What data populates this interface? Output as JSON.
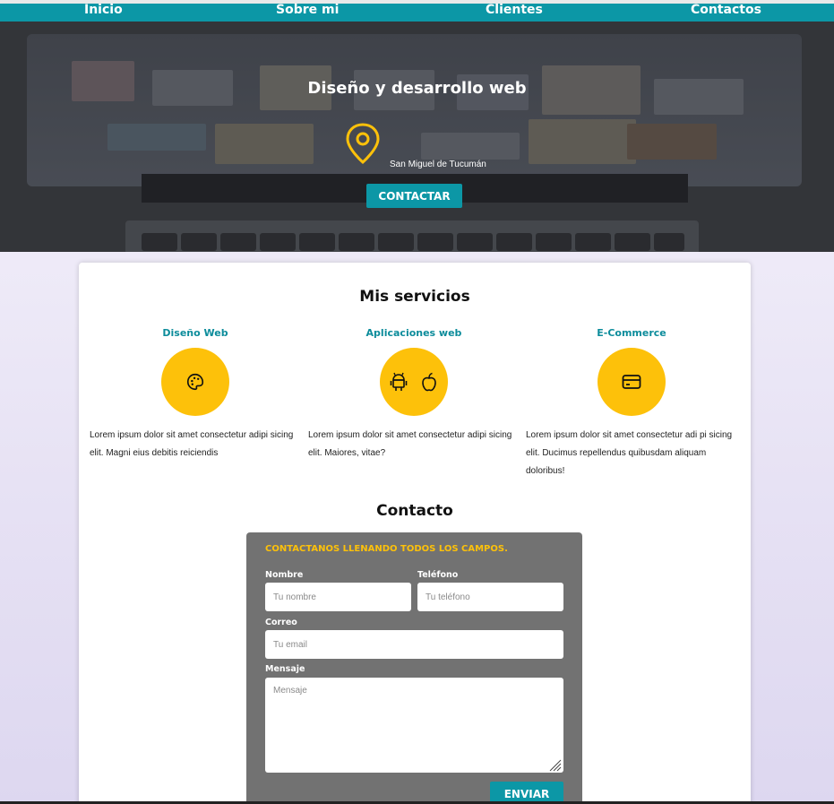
{
  "nav": {
    "items": [
      {
        "label": "Inicio"
      },
      {
        "label": "Sobre mi"
      },
      {
        "label": "Clientes"
      },
      {
        "label": "Contactos"
      }
    ]
  },
  "hero": {
    "title": "Diseño y desarrollo web",
    "location": "San Miguel de Tucumán",
    "button": "CONTACTAR",
    "icon": "location-pin-icon"
  },
  "services": {
    "title": "Mis servicios",
    "items": [
      {
        "name": "Diseño Web",
        "icon": "palette-icon",
        "desc": "Lorem ipsum dolor sit amet consectetur adipi sicing elit. Magni eius debitis reiciendis"
      },
      {
        "name": "Aplicaciones web",
        "icon": "android-apple-icons",
        "desc": "Lorem ipsum dolor sit amet consectetur adipi sicing elit. Maiores, vitae?"
      },
      {
        "name": "E-Commerce",
        "icon": "credit-card-icon",
        "desc": "Lorem ipsum dolor sit amet consectetur adi pi sicing elit. Ducimus repellendus quibusdam aliquam doloribus!"
      }
    ]
  },
  "contact": {
    "title": "Contacto",
    "heading": "CONTACTANOS LLENANDO TODOS LOS CAMPOS.",
    "fields": {
      "nombre": {
        "label": "Nombre",
        "placeholder": "Tu nombre"
      },
      "telefono": {
        "label": "Teléfono",
        "placeholder": "Tu teléfono"
      },
      "correo": {
        "label": "Correo",
        "placeholder": "Tu email"
      },
      "mensaje": {
        "label": "Mensaje",
        "placeholder": "Mensaje"
      }
    },
    "button": "ENVIAR"
  },
  "colors": {
    "accent": "#0c97a6",
    "highlight": "#fdc10a",
    "form_bg": "#727272"
  }
}
